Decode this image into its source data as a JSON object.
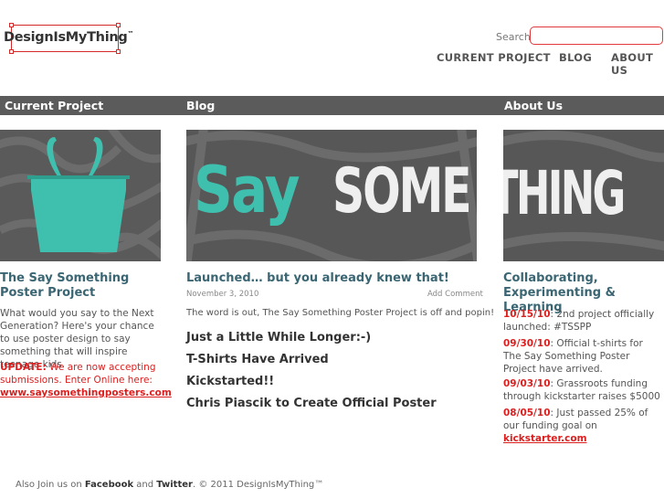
{
  "logo": {
    "text": "DesignIsMyThing",
    "tm": "™"
  },
  "search": {
    "label": "Search",
    "placeholder": ""
  },
  "nav": {
    "current_project": "CURRENT PROJECT",
    "blog": "BLOG",
    "about_us": "ABOUT US"
  },
  "bar": {
    "current_project": "Current Project",
    "blog": "Blog",
    "about_us": "About Us"
  },
  "images": {
    "blog_word_1": "Say",
    "blog_word_2": "SOME",
    "about_word": "THING"
  },
  "current_project": {
    "title": "The Say Something Poster Project",
    "body": "What would you say to the Next Generation? Here's your chance to use poster design to say something that will inspire teenage kids.",
    "update_label": "UPDATE:",
    "update_text": " We are now accepting submissions. Enter Online here:",
    "update_link": "www.saysomethingposters.com"
  },
  "blog": {
    "post_title": "Launched… but you already knew that!",
    "post_date": "November 3, 2010",
    "add_comment": "Add Comment",
    "post_excerpt": "The word is out, The Say Something Poster Project is off and popin!",
    "links": [
      "Just a Little While Longer:-)",
      "T-Shirts Have Arrived",
      "Kickstarted!!",
      "Chris Piascik to Create Official Poster"
    ]
  },
  "about": {
    "title": "Collaborating, Experimenting & Learning",
    "items": [
      {
        "date": "10/15/10",
        "text": ": 2nd project officially launched: #TSSPP",
        "link": ""
      },
      {
        "date": "09/30/10",
        "text": ": Official t-shirts for The Say Something Poster Project have arrived.",
        "link": ""
      },
      {
        "date": "09/03/10",
        "text": ": Grassroots funding through kickstarter raises $5000",
        "link": ""
      },
      {
        "date": "08/05/10",
        "text": ": Just passed 25% of our funding goal on ",
        "link": "kickstarter.com"
      }
    ]
  },
  "footer": {
    "prefix": "Also Join us on ",
    "facebook": "Facebook",
    "and": " and ",
    "twitter": "Twitter",
    "suffix": ". © 2011 DesignIsMyThing™"
  },
  "colors": {
    "accent_red": "#dc1f1f",
    "teal": "#3fbfae",
    "bar_grey": "#5b5b5b",
    "title_blue": "#3a6673"
  }
}
